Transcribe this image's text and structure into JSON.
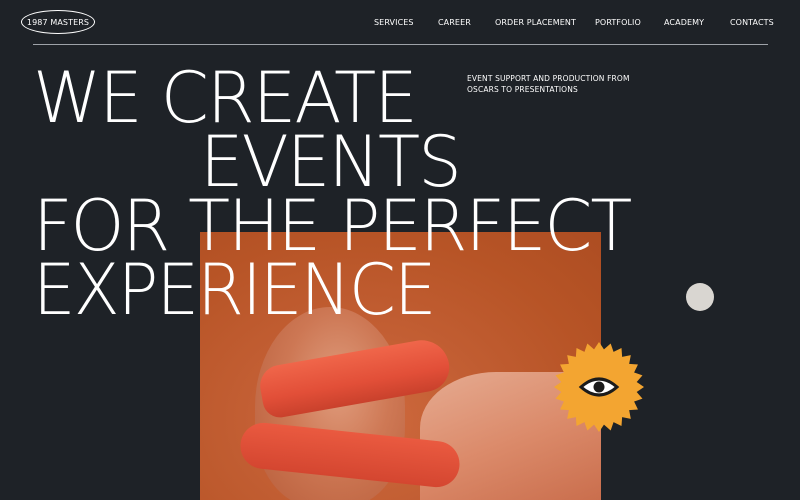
{
  "brand": {
    "logo": "1987 MASTERS"
  },
  "nav": {
    "items": [
      {
        "label": "SERVICES"
      },
      {
        "label": "CAREER"
      },
      {
        "label": "ORDER PLACEMENT"
      },
      {
        "label": "PORTFOLIO"
      },
      {
        "label": "ACADEMY"
      },
      {
        "label": "CONTACTS"
      }
    ]
  },
  "hero": {
    "tagline": [
      "EVENT SUPPORT AND PRODUCTION FROM",
      "OSCARS TO PRESENTATIONS"
    ],
    "headline": [
      "WE CREATE",
      "EVENTS",
      "FOR THE PERFECT",
      "EXPERIENCE"
    ]
  },
  "colors": {
    "background": "#1e2227",
    "text": "#ffffff",
    "accent_orange": "#c25e33",
    "badge_yellow": "#f3a531",
    "dot": "#d9d6d1"
  },
  "icons": {
    "badge": "eye-icon"
  }
}
